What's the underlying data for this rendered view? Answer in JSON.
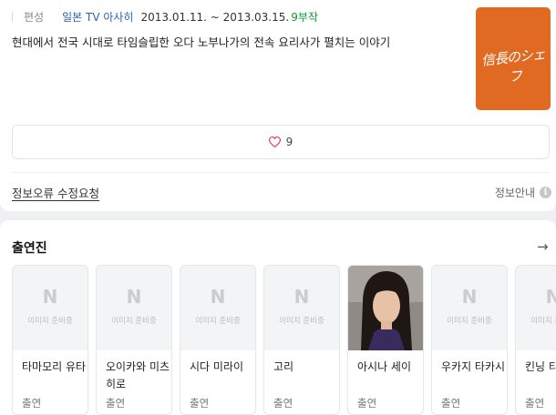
{
  "info": {
    "label": "편성",
    "network": "일본 TV 아사히",
    "dates": "2013.01.11. ~ 2013.03.15.",
    "episodes": "9부작",
    "description": "현대에서 전국 시대로 타임슬립한 오다 노부나가의 전속 요리사가 펼치는 이야기",
    "poster_title": "信長のシェフ"
  },
  "like": {
    "count": "9"
  },
  "links": {
    "report": "정보오류 수정요청",
    "info": "정보안내",
    "info_icon": "i"
  },
  "cast": {
    "title": "출연진",
    "arrow": "→",
    "placeholder_n": "N",
    "placeholder_text": "이미지 준비중",
    "items": [
      {
        "name": "타마모리 유타",
        "role": "출연"
      },
      {
        "name": "오이카와 미츠히로",
        "role": "출연"
      },
      {
        "name": "시다 미라이",
        "role": "출연"
      },
      {
        "name": "고리",
        "role": "출연"
      },
      {
        "name": "아시나 세이",
        "role": "출연"
      },
      {
        "name": "우카지 타카시",
        "role": "출연"
      },
      {
        "name": "킨닝 티 야마",
        "role": "출연"
      }
    ]
  },
  "colors": {
    "accent_green": "#0a9b37",
    "link_blue": "#2a63b5",
    "poster_orange": "#e06a22"
  }
}
